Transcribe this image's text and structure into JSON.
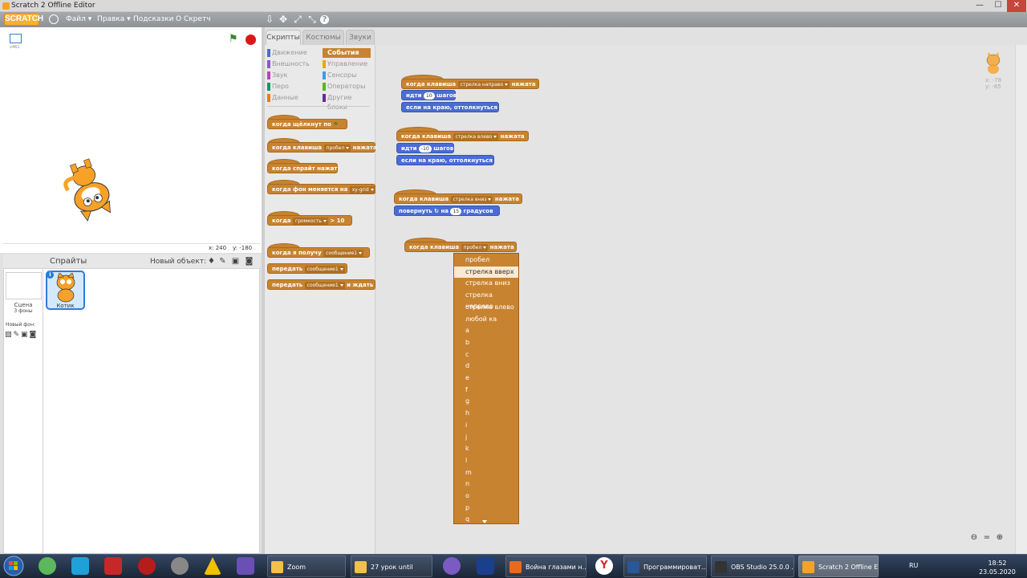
{
  "window": {
    "title": "Scratch 2 Offline Editor",
    "min": "—",
    "max": "☐",
    "close": "✕"
  },
  "menu": {
    "logo": "SCRATCH",
    "file": "Файл ▾",
    "edit": "Правка ▾",
    "tips": "Подсказки",
    "about": "О Скретч"
  },
  "stage": {
    "version": "v461",
    "x_label": "x: 240",
    "y_label": "y: -180"
  },
  "sprites": {
    "title": "Спрайты",
    "new_object": "Новый объект:",
    "scene_label": "Сцена",
    "scene_backdrops": "3 фоны",
    "new_backdrop": "Новый фон:",
    "sprite_name": "Котик"
  },
  "tabs": {
    "scripts": "Скрипты",
    "costumes": "Костюмы",
    "sounds": "Звуки"
  },
  "categories": [
    {
      "label": "Движение",
      "color": "#4a6cd4"
    },
    {
      "label": "Внешность",
      "color": "#8a55d7"
    },
    {
      "label": "Звук",
      "color": "#bb42c3"
    },
    {
      "label": "Перо",
      "color": "#0e9a6c"
    },
    {
      "label": "Данные",
      "color": "#ee7d16"
    },
    {
      "label": "События",
      "color": "#c88330"
    },
    {
      "label": "Управление",
      "color": "#e1a91a"
    },
    {
      "label": "Сенсоры",
      "color": "#2ca5e2"
    },
    {
      "label": "Операторы",
      "color": "#5cb712"
    },
    {
      "label": "Другие блоки",
      "color": "#632d99"
    }
  ],
  "palette": {
    "flag_click": "когда щёлкнут по",
    "key_press": "когда клавиша",
    "key_arg": "пробел",
    "pressed": "нажата",
    "sprite_click": "когда спрайт нажат",
    "bg_switch": "когда фон меняется на",
    "bg_arg": "xy-grid",
    "loudness": "когда",
    "loudness_arg": "громкость",
    "gt": "> 10",
    "receive": "когда я получу",
    "msg": "сообщение1",
    "broadcast": "передать",
    "broadcast_wait": "и ждать"
  },
  "scripts": {
    "s1_hat": "когда клавиша",
    "s1_key": "стрелка направо",
    "pressed": "нажата",
    "move": "идти",
    "move_n1": "10",
    "steps": "шагов",
    "bounce": "если на краю, оттолкнуться",
    "s2_key": "стрелка влево",
    "move_n2": "-10",
    "s3_key": "стрелка вниз",
    "turn": "повернуть",
    "turn_on": "на",
    "turn_n": "15",
    "degrees": "градусов",
    "s4_key": "пробел"
  },
  "dropdown": {
    "items": [
      "пробел",
      "стрелка вверх",
      "стрелка вниз",
      "стрелка направо",
      "стрелка влево",
      "любой ка",
      "a",
      "b",
      "c",
      "d",
      "e",
      "f",
      "g",
      "h",
      "i",
      "j",
      "k",
      "l",
      "m",
      "n",
      "o",
      "p",
      "q"
    ],
    "highlighted": "стрелка вверх"
  },
  "sprite_mini": {
    "x": "x: -78",
    "y": "y: -85"
  },
  "taskbar": {
    "apps": [
      {
        "label": "Zoom",
        "color": "#f2c04b"
      },
      {
        "label": "27 урок until",
        "color": "#f2c04b"
      },
      {
        "label": "Война глазами н...",
        "color": "#e86a1e"
      },
      {
        "label": "Программироват...",
        "color": "#2b5797"
      },
      {
        "label": "OBS Studio 25.0.0 ...",
        "color": "#333333"
      },
      {
        "label": "Scratch 2 Offline E...",
        "color": "#f4a22d"
      }
    ],
    "lang": "RU",
    "time": "18:52",
    "date": "23.05.2020"
  }
}
